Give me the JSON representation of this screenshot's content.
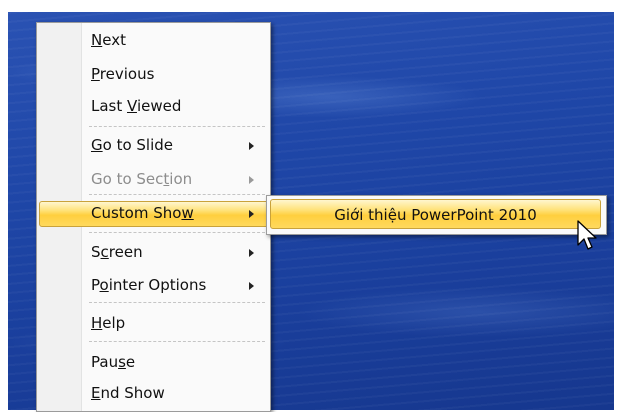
{
  "context_menu": {
    "items": [
      {
        "pre": "",
        "key": "N",
        "post": "ext",
        "disabled": false,
        "submenu": false
      },
      {
        "pre": "",
        "key": "P",
        "post": "revious",
        "disabled": false,
        "submenu": false
      },
      {
        "pre": "Last ",
        "key": "V",
        "post": "iewed",
        "disabled": false,
        "submenu": false
      },
      {
        "pre": "",
        "key": "G",
        "post": "o to Slide",
        "disabled": false,
        "submenu": true
      },
      {
        "pre": "Go to Sec",
        "key": "t",
        "post": "ion",
        "disabled": true,
        "submenu": true
      },
      {
        "pre": "Custom Sho",
        "key": "w",
        "post": "",
        "disabled": false,
        "submenu": true,
        "highlighted": true
      },
      {
        "pre": "S",
        "key": "c",
        "post": "reen",
        "disabled": false,
        "submenu": true
      },
      {
        "pre": "P",
        "key": "o",
        "post": "inter Options",
        "disabled": false,
        "submenu": true
      },
      {
        "pre": "",
        "key": "H",
        "post": "elp",
        "disabled": false,
        "submenu": false
      },
      {
        "pre": "Pau",
        "key": "s",
        "post": "e",
        "disabled": false,
        "submenu": false
      },
      {
        "pre": "",
        "key": "E",
        "post": "nd Show",
        "disabled": false,
        "submenu": false
      }
    ]
  },
  "custom_show_submenu": {
    "items": [
      {
        "label": "Giới thiệu PowerPoint 2010",
        "highlighted": true
      }
    ]
  },
  "colors": {
    "slide_background": "#1f47a8",
    "highlight": "#ffcf3e"
  }
}
